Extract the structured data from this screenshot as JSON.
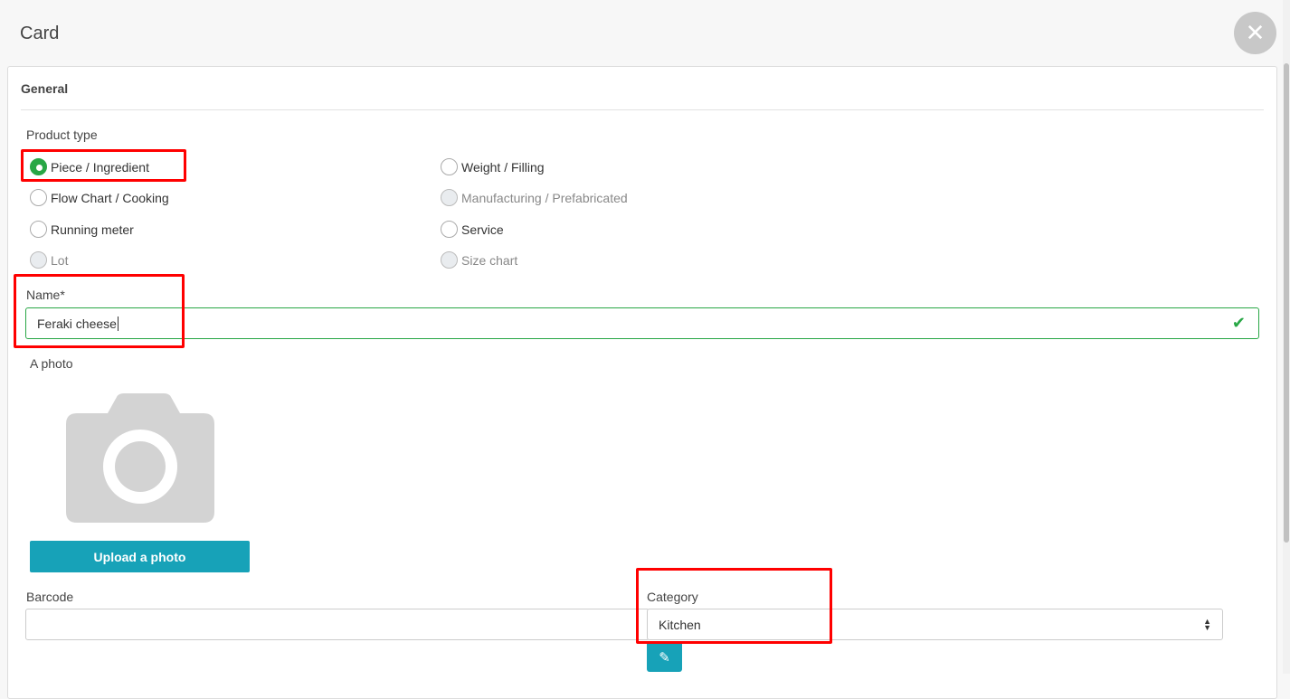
{
  "dialog": {
    "title": "Card",
    "close_icon": "close-icon"
  },
  "section": {
    "title": "General"
  },
  "product_type": {
    "label": "Product type",
    "options": [
      {
        "label": "Piece / Ingredient",
        "state": "selected"
      },
      {
        "label": "Weight / Filling",
        "state": "enabled"
      },
      {
        "label": "Flow Chart / Cooking",
        "state": "enabled"
      },
      {
        "label": "Manufacturing / Prefabricated",
        "state": "disabled"
      },
      {
        "label": "Running meter",
        "state": "enabled"
      },
      {
        "label": "Service",
        "state": "enabled"
      },
      {
        "label": "Lot",
        "state": "disabled"
      },
      {
        "label": "Size chart",
        "state": "disabled"
      }
    ]
  },
  "name": {
    "label": "Name*",
    "value": "Feraki cheese"
  },
  "photo": {
    "label": "A photo",
    "upload_label": "Upload a photo"
  },
  "barcode": {
    "label": "Barcode",
    "value": ""
  },
  "category": {
    "label": "Category",
    "value": "Kitchen"
  },
  "colors": {
    "accent": "#17a2b8",
    "valid": "#28a745",
    "highlight": "#ff0000"
  }
}
